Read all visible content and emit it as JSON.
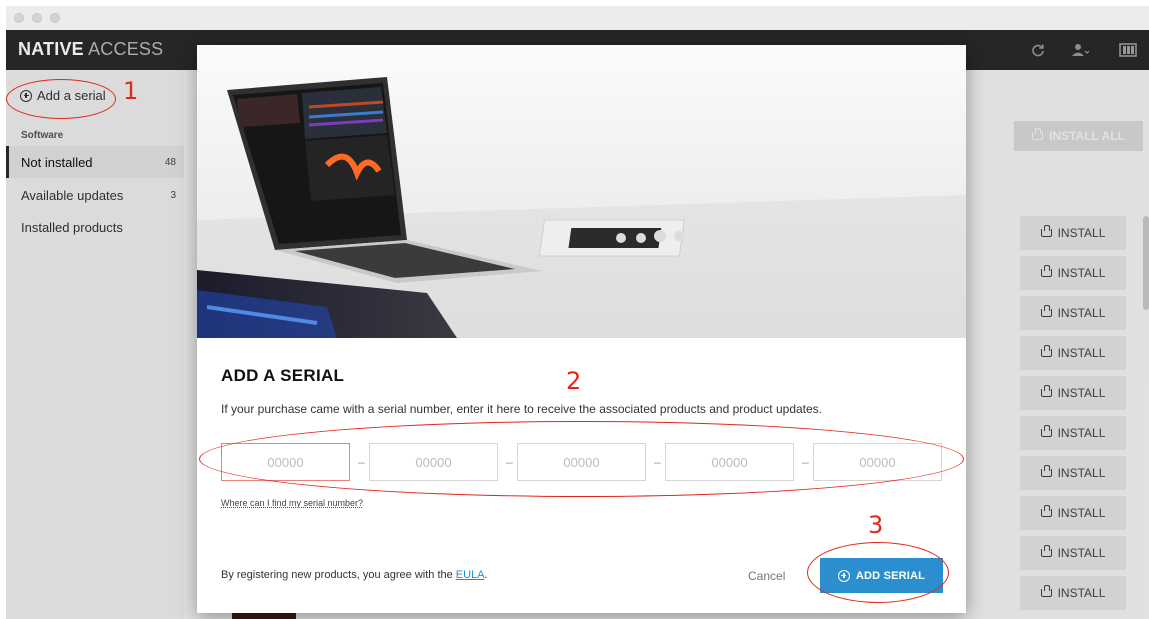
{
  "brand": {
    "bold": "NATIVE",
    "light": "ACCESS"
  },
  "header_icons": [
    "refresh-icon",
    "user-icon",
    "komplete-kontrol-icon"
  ],
  "sidebar": {
    "add_serial_label": "Add a serial",
    "section_title": "Software",
    "items": [
      {
        "label": "Not installed",
        "count": "48",
        "active": true
      },
      {
        "label": "Available updates",
        "count": "3",
        "active": false
      },
      {
        "label": "Installed products",
        "count": "",
        "active": false
      }
    ]
  },
  "main": {
    "install_all_label": "INSTALL ALL",
    "install_label": "INSTALL",
    "install_rows": 10
  },
  "modal": {
    "title": "ADD A SERIAL",
    "description": "If your purchase came with a serial number, enter it here to receive the associated products and product updates.",
    "serial_placeholder": "00000",
    "separator": "–",
    "help_link": "Where can I find my serial number?",
    "agree_prefix": "By registering new products, you agree with the ",
    "eula_label": "EULA",
    "agree_suffix": ".",
    "cancel_label": "Cancel",
    "submit_label": "ADD SERIAL"
  },
  "annotations": [
    "1",
    "2",
    "3"
  ],
  "colors": {
    "appbar": "#2a2a2a",
    "primary": "#2b8fcf",
    "annotation": "#e2271d",
    "invalid_field_border": "#e5837c"
  }
}
